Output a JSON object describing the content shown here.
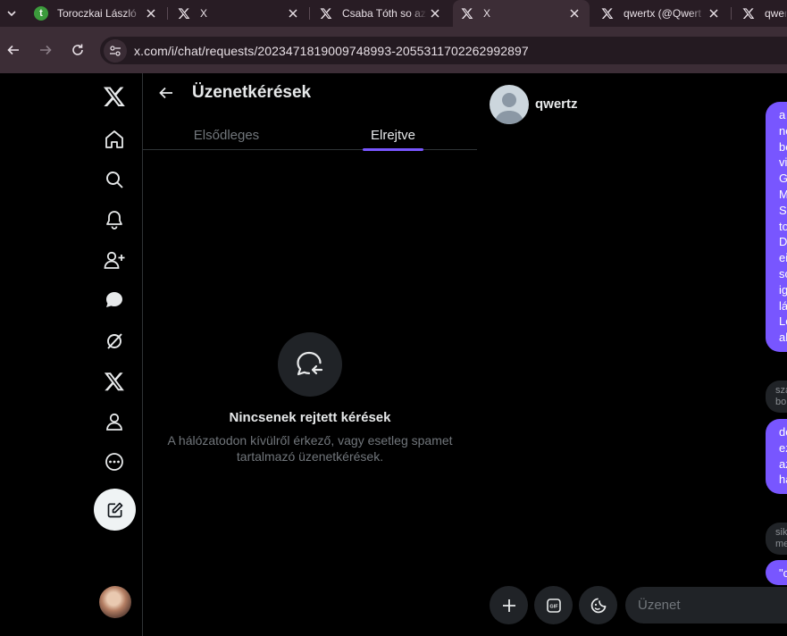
{
  "browser": {
    "tabs": [
      {
        "title": "Toroczkai László",
        "favicon": "t-icon",
        "active": false
      },
      {
        "title": "X",
        "favicon": "x-logo-icon",
        "active": false
      },
      {
        "title": "Csaba Tóth so az",
        "favicon": "x-logo-icon",
        "active": false
      },
      {
        "title": "X",
        "favicon": "x-logo-icon",
        "active": true
      },
      {
        "title": "qwertx (@Qwert",
        "favicon": "x-logo-icon",
        "active": false
      },
      {
        "title": "qwer",
        "favicon": "x-logo-icon",
        "active": false
      }
    ],
    "url": "x.com/i/chat/requests/2023471819009748993-2055311702262992897"
  },
  "nav": {
    "items": [
      "x-logo-icon",
      "home-icon",
      "search-icon",
      "notifications-icon",
      "follow-icon",
      "chat-icon",
      "grok-icon",
      "premium-x-icon",
      "profile-icon",
      "more-icon"
    ]
  },
  "requests": {
    "title": "Üzenetkérések",
    "tabs": [
      "Elsődleges",
      "Elrejtve"
    ],
    "active_tab": "Elrejtve",
    "empty_title": "Nincsenek rejtett kérések",
    "empty_desc": "A hálózatodon kívülről érkező, vagy esetleg spamet tartalmazó üzenetkérések."
  },
  "chat": {
    "name": "qwertz",
    "bubbles": [
      {
        "lines": "a\nne\nbe\nvi\nG\nM\nS:\nto\nD\nei\nso\nig\nlá\nLé\nal"
      },
      {
        "lines": "sza\nbo",
        "gray": true
      },
      {
        "lines": "do\nez\naz\nha"
      },
      {
        "lines": "sik\nme",
        "gray": true
      },
      {
        "lines": "\"c"
      }
    ],
    "input_placeholder": "Üzenet"
  },
  "colors": {
    "accent": "#7856ff",
    "background": "#000000",
    "chrome": "#3c2d36"
  }
}
